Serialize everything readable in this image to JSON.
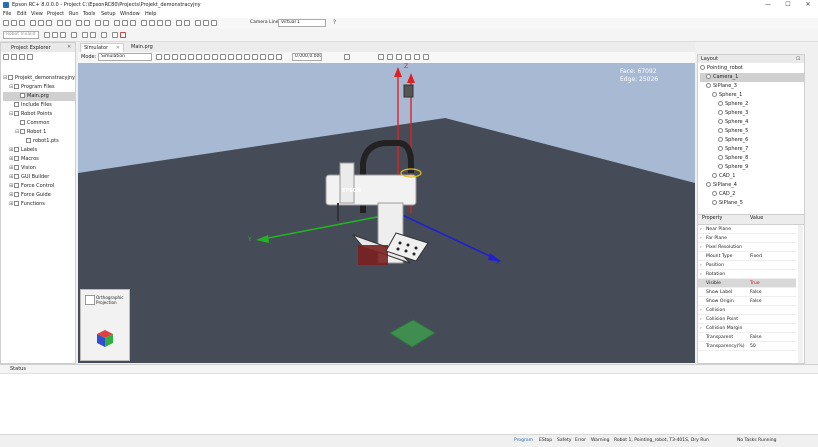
{
  "window": {
    "title": "Epson RC+ 8.0.0.0 - Project C:\\EpsonRC80\\Projects\\Projekt_demonstracyjny",
    "minimize": "—",
    "maximize": "☐",
    "close": "✕"
  },
  "menu": [
    "File",
    "Edit",
    "View",
    "Project",
    "Run",
    "Tools",
    "Setup",
    "Window",
    "Help"
  ],
  "toolbar": {
    "camera_label": "Camera Line",
    "camera_value": "Virtual 1",
    "help": "?"
  },
  "toolbar2": {
    "robot_select": "Robot Invalid"
  },
  "explorer": {
    "tab_label": "Project Explorer",
    "items": [
      {
        "label": "Projekt_demonstracyjny",
        "indent": 0,
        "toggle": "⊟"
      },
      {
        "label": "Program Files",
        "indent": 1,
        "toggle": "⊟"
      },
      {
        "label": "Main.prg",
        "indent": 2,
        "toggle": "",
        "selected": true
      },
      {
        "label": "Include Files",
        "indent": 1,
        "toggle": ""
      },
      {
        "label": "Robot Points",
        "indent": 1,
        "toggle": "⊟"
      },
      {
        "label": "Common",
        "indent": 2,
        "toggle": ""
      },
      {
        "label": "Robot 1",
        "indent": 2,
        "toggle": "⊟"
      },
      {
        "label": "robot1.pts",
        "indent": 3,
        "toggle": ""
      },
      {
        "label": "Labels",
        "indent": 1,
        "toggle": "⊞"
      },
      {
        "label": "Macros",
        "indent": 1,
        "toggle": "⊞"
      },
      {
        "label": "Vision",
        "indent": 1,
        "toggle": "⊞"
      },
      {
        "label": "GUI Builder",
        "indent": 1,
        "toggle": "⊞"
      },
      {
        "label": "Force Control",
        "indent": 1,
        "toggle": "⊞"
      },
      {
        "label": "Force Guide",
        "indent": 1,
        "toggle": "⊞"
      },
      {
        "label": "Functions",
        "indent": 1,
        "toggle": "⊞"
      }
    ]
  },
  "doc_tabs": [
    {
      "label": "Simulator",
      "active": true
    },
    {
      "label": "Main.prg",
      "active": false
    }
  ],
  "sim": {
    "mode_label": "Mode:",
    "mode_value": "Simulation",
    "coords": "0.000,0.000,0.000",
    "face_label": "Face: 67092",
    "edge_label": "Edge: 25026",
    "view_cube_label": "Orthographic Projection",
    "axis_x": "X",
    "axis_y": "Y",
    "axis_z": "Z",
    "robot_brand": "EPSON"
  },
  "layout_tree": {
    "header": "Layout",
    "items": [
      {
        "label": "Pointing_robot",
        "indent": 0
      },
      {
        "label": "Camera_1",
        "indent": 1,
        "selected": true
      },
      {
        "label": "SiPlane_3",
        "indent": 1
      },
      {
        "label": "Sphere_1",
        "indent": 2
      },
      {
        "label": "Sphere_2",
        "indent": 3
      },
      {
        "label": "Sphere_3",
        "indent": 3
      },
      {
        "label": "Sphere_4",
        "indent": 3
      },
      {
        "label": "Sphere_5",
        "indent": 3
      },
      {
        "label": "Sphere_6",
        "indent": 3
      },
      {
        "label": "Sphere_7",
        "indent": 3
      },
      {
        "label": "Sphere_8",
        "indent": 3
      },
      {
        "label": "Sphere_9",
        "indent": 3
      },
      {
        "label": "CAD_1",
        "indent": 2
      },
      {
        "label": "SiPlane_4",
        "indent": 1
      },
      {
        "label": "CAD_2",
        "indent": 2
      },
      {
        "label": "SiPlane_5",
        "indent": 2
      }
    ]
  },
  "properties": {
    "col_property": "Property",
    "col_value": "Value",
    "rows": [
      {
        "label": "Near Plane",
        "value": "",
        "exp": "›"
      },
      {
        "label": "Far Plane",
        "value": "",
        "exp": "›"
      },
      {
        "label": "Pixel Resolution",
        "value": "",
        "exp": "›"
      },
      {
        "label": "Mount Type",
        "value": "Fixed",
        "exp": ""
      },
      {
        "label": "Position",
        "value": "",
        "exp": "›"
      },
      {
        "label": "Rotation",
        "value": "",
        "exp": "›"
      },
      {
        "label": "Visible",
        "value": "True",
        "exp": "",
        "highlight": true
      },
      {
        "label": "Show Label",
        "value": "False",
        "exp": ""
      },
      {
        "label": "Show Origin",
        "value": "False",
        "exp": ""
      },
      {
        "label": "Collision",
        "value": "",
        "exp": "›"
      },
      {
        "label": "Collision Point",
        "value": "",
        "exp": "›"
      },
      {
        "label": "Collision Margin",
        "value": "",
        "exp": "›"
      },
      {
        "label": "Transparent",
        "value": "False",
        "exp": ""
      },
      {
        "label": "Transparency(%)",
        "value": "50",
        "exp": ""
      }
    ]
  },
  "status_panel": {
    "title": "Status"
  },
  "statusbar": {
    "program": "Program",
    "estop": "EStop",
    "safety": "Safety",
    "error": "Error",
    "warning": "Warning",
    "robot": "Robot 1, Pointing_robot, T3-401S, Dry Run",
    "tasks": "No Tasks Running"
  },
  "colors": {
    "accent": "#2a6fb5",
    "viewport_bg": "#a8b9d4",
    "floor": "#454c57",
    "axis_x": "#2020d0",
    "axis_y": "#22b322",
    "axis_z": "#e02020",
    "selected": "#d0d0d0"
  }
}
